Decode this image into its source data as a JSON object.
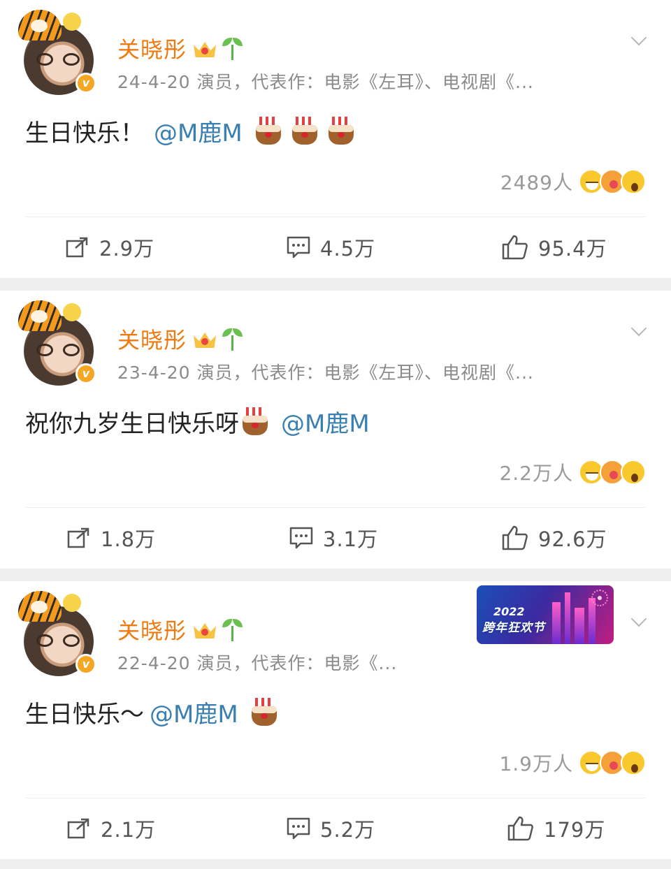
{
  "posts": [
    {
      "author": "关晓彤",
      "meta": "24-4-20  演员，代表作：电影《左耳》、电视剧《...",
      "text": "生日快乐！",
      "mention": "@M鹿M",
      "cakes": 3,
      "reactions_count": "2489人",
      "repost": "2.9万",
      "comments": "4.5万",
      "likes": "95.4万"
    },
    {
      "author": "关晓彤",
      "meta": "23-4-20  演员，代表作：电影《左耳》、电视剧《...",
      "text": "祝你九岁生日快乐呀",
      "mention": "@M鹿M",
      "cakes": 1,
      "reactions_count": "2.2万人",
      "repost": "1.8万",
      "comments": "3.1万",
      "likes": "92.6万"
    },
    {
      "author": "关晓彤",
      "meta": "22-4-20  演员，代表作：电影《...",
      "text": "生日快乐～",
      "mention": "@M鹿M",
      "cakes": 1,
      "reactions_count": "1.9万人",
      "repost": "2.1万",
      "comments": "5.2万",
      "likes": "179万",
      "banner": {
        "year": "2022",
        "title": "跨年狂欢节"
      }
    }
  ],
  "icons": {
    "avatar_badge": "v-verified-badge",
    "crown": "crown-icon",
    "sprout": "sprout-icon",
    "more": "chevron-down-icon",
    "repost": "share-icon",
    "comment": "comment-icon",
    "like": "thumbs-up-icon",
    "reactions": [
      "laugh-emoji",
      "kiss-emoji",
      "wow-emoji"
    ]
  },
  "colors": {
    "author_name": "#f07a12",
    "mention": "#3a7fb2",
    "meta": "#8a8a8a",
    "separator": "#efefef"
  }
}
